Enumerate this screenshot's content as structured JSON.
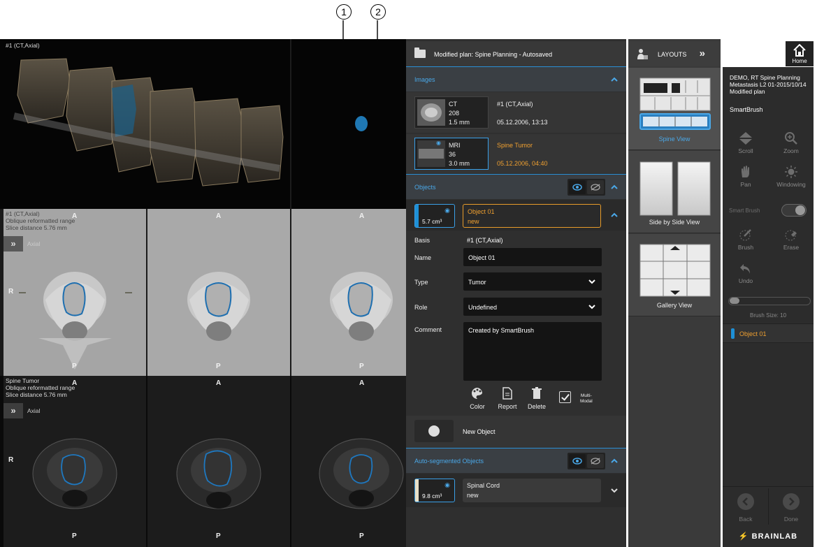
{
  "callouts": [
    "1",
    "2"
  ],
  "viewer": {
    "view3d_label": "#1 (CT,Axial)",
    "ct_row": {
      "title_lines": [
        "#1 (CT,Axial)",
        "Oblique reformatted range",
        "Slice distance 5.76 mm"
      ],
      "plane": "Axial",
      "orient_top": "A",
      "orient_bottom": "P",
      "orient_left": "R"
    },
    "mr_row": {
      "title_lines": [
        "Spine Tumor",
        "Oblique reformatted range",
        "Slice distance 5.76 mm"
      ],
      "plane": "Axial",
      "orient_top": "A",
      "orient_bottom": "P",
      "orient_left": "R"
    },
    "expand_glyph": "»"
  },
  "panel": {
    "header_title": "Modified plan: Spine Planning - Autosaved",
    "images_section": "Images",
    "images": [
      {
        "modality": "CT",
        "count": "208",
        "thickness": "1.5 mm",
        "name": "#1 (CT,Axial)",
        "date": "05.12.2006, 13:13",
        "selected": false
      },
      {
        "modality": "MRI",
        "count": "36",
        "thickness": "3.0 mm",
        "name": "Spine Tumor",
        "date": "05.12.2006, 04:40",
        "selected": true
      }
    ],
    "objects_section": "Objects",
    "object": {
      "volume": "5.7 cm³",
      "name": "Object 01",
      "status": "new",
      "basis_label": "Basis",
      "basis_value": "#1 (CT,Axial)",
      "name_label": "Name",
      "name_value": "Object 01",
      "type_label": "Type",
      "type_value": "Tumor",
      "role_label": "Role",
      "role_value": "Undefined",
      "comment_label": "Comment",
      "comment_value": "Created by SmartBrush"
    },
    "tools": {
      "color": "Color",
      "report": "Report",
      "delete": "Delete",
      "multimodal_1": "Multi-",
      "multimodal_2": "Modal"
    },
    "new_object": "New Object",
    "auto_section": "Auto-segmented Objects",
    "auto_object": {
      "volume": "9.8 cm³",
      "name": "Spinal Cord",
      "status": "new"
    }
  },
  "layouts": {
    "title": "LAYOUTS",
    "double_arrow": "»",
    "items": [
      {
        "label": "Spine View",
        "selected": true
      },
      {
        "label": "Side by Side View",
        "selected": false
      },
      {
        "label": "Gallery View",
        "selected": false
      }
    ]
  },
  "home": {
    "label": "Home"
  },
  "sidebar": {
    "patient_lines": [
      "DEMO, RT Spine Planning",
      "Metastasis L2 01-2015/10/14",
      "Modified plan"
    ],
    "title": "SmartBrush",
    "scroll": "Scroll",
    "zoom": "Zoom",
    "pan": "Pan",
    "windowing": "Windowing",
    "smart_brush": "Smart Brush",
    "brush": "Brush",
    "erase": "Erase",
    "undo": "Undo",
    "brush_size": "Brush Size: 10",
    "brush_size_value": 10,
    "object_item": "Object 01",
    "back": "Back",
    "done": "Done",
    "brand": "BRAINLAB"
  },
  "colors": {
    "accent_blue": "#3aa0e8",
    "accent_orange": "#f0a030",
    "panel_bg": "#2f2f2f"
  }
}
